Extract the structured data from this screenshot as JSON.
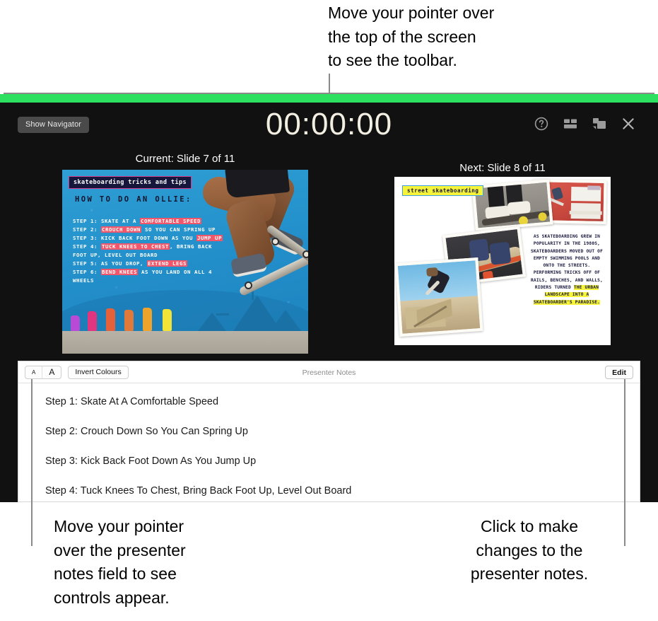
{
  "callouts": {
    "top": "Move your pointer over\nthe top of the screen\nto see the toolbar.",
    "bottom_left": "Move your pointer\nover the presenter\nnotes field to see\ncontrols appear.",
    "bottom_right": "Click to make\nchanges to the\npresenter notes."
  },
  "presenter": {
    "accent_color": "#2ee05f",
    "background_color": "#111111",
    "show_navigator_label": "Show Navigator",
    "timer": "00:00:00",
    "toolbar_icons": [
      "help-icon",
      "layout-icon",
      "swap-displays-icon",
      "close-icon"
    ],
    "current_slide_label": "Current: Slide 7 of 11",
    "next_slide_label": "Next: Slide 8 of 11"
  },
  "slide_current": {
    "title": "skateboarding tricks and tips",
    "heading": "HOW TO DO AN OLLIE:",
    "steps": [
      {
        "label": "STEP 1:",
        "plain_before": "SKATE AT A ",
        "highlight": "COMFORTABLE SPEED",
        "plain_after": ""
      },
      {
        "label": "STEP 2:",
        "plain_before": "",
        "highlight": "CROUCH DOWN",
        "plain_after": " SO YOU CAN SPRING UP"
      },
      {
        "label": "STEP 3:",
        "plain_before": "KICK BACK FOOT DOWN AS YOU ",
        "highlight": "JUMP UP",
        "plain_after": ""
      },
      {
        "label": "STEP 4:",
        "plain_before": "",
        "highlight": "TUCK KNEES TO CHEST",
        "plain_after": ", BRING BACK FOOT UP, LEVEL OUT BOARD"
      },
      {
        "label": "STEP 5:",
        "plain_before": "AS YOU DROP, ",
        "highlight": "EXTEND LEGS",
        "plain_after": ""
      },
      {
        "label": "STEP 6:",
        "plain_before": "",
        "highlight": "BEND KNEES",
        "plain_after": " AS YOU LAND ON ALL 4 WHEELS"
      }
    ],
    "highlight_color": "#f2566a"
  },
  "slide_next": {
    "title": "street skateboarding",
    "body_plain_1": "AS SKATEBOARDING GREW IN POPULARITY IN THE 1980S, SKATEBOARDERS MOVED OUT OF EMPTY SWIMMING POOLS AND ONTO THE STREETS. PERFORMING TRICKS OFF OF RAILS, BENCHES, AND WALLS, RIDERS TURNED ",
    "body_highlight": "THE URBAN LANDSCAPE INTO A SKATEBOARDER'S PARADISE.",
    "highlight_color": "#f5f33a"
  },
  "notes": {
    "panel_title": "Presenter Notes",
    "size_small_label": "A",
    "size_large_label": "A",
    "invert_label": "Invert Colours",
    "edit_label": "Edit",
    "lines": [
      "Step 1: Skate At A Comfortable Speed",
      "Step 2: Crouch Down So You Can Spring Up",
      "Step 3: Kick Back Foot Down As You Jump Up",
      "Step 4: Tuck Knees To Chest, Bring Back Foot Up, Level Out Board"
    ]
  }
}
